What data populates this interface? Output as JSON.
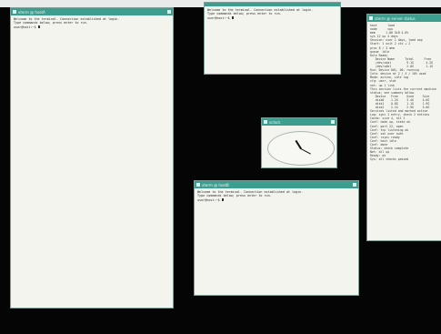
{
  "windows": {
    "term_left": {
      "title": "xterm @ hostA",
      "lines": [
        "Welcome to the terminal. Connection established at login.",
        "Type commands below; press enter to run.",
        "user@host:~$ "
      ]
    },
    "term_top": {
      "title": "xterm",
      "lines": [
        "Welcome to the terminal. Connection established at login.",
        "Type commands below; press enter to run.",
        "user@host:~$ "
      ]
    },
    "clock": {
      "title": "xclock"
    },
    "term_bottom": {
      "title": "xterm @ hostB",
      "lines": [
        "Welcome to the terminal. Connection established at login.",
        "Type commands below; press enter to run.",
        "user@host:~$ "
      ]
    },
    "term_right": {
      "title": "xterm @ server status",
      "lines": [
        "host      load",
        "node      cpu",
        "mem      1.00 GiB 4.0%",
        "sys 12 up 4 days",
        "Session: user 1 days, load avg",
        "Start: 1 unit 2 ctx + 2",
        "proc 8 / 3 mem",
        "queue  idle",
        "Rule Ready",
        "",
        "   Device Name      Total      Free",
        "   /dev/sda1         9.1G       4.2G",
        "   /dev/sdb1         2.0G       1.1G",
        "",
        "Run: Device 001, 00: running",
        "Info: device at 2 / 4 / 10% used",
        "Mode: active, idle log",
        "cfg: user, stat",
        "net: up 1 link",
        "",
        "This section lists the current machine",
        "status; see summary below.",
        "",
        "   Device   Free     Used     Size",
        "   disk0    1.2G     3.4G     4.6G",
        "   disk1    0.8G     1.1G     1.9G",
        "   disk2    2.1G     2.9G     5.0G",
        "",
        "Services listed and marked active",
        "Log: sync 1 entry, check 2 entries",
        "Cache: size 4, hit 2",
        "",
        "Conf: node up, state ok",
        "Conf: port 22, open",
        "Conf: tcp listening ok",
        "Conf: ssh user auth",
        "Conf: rsync ready",
        "Conf: host idle",
        "Conf: done",
        "Status: check complete",
        "Net: all up",
        "Ready: ok",
        "Sys: all checks passed"
      ]
    }
  }
}
